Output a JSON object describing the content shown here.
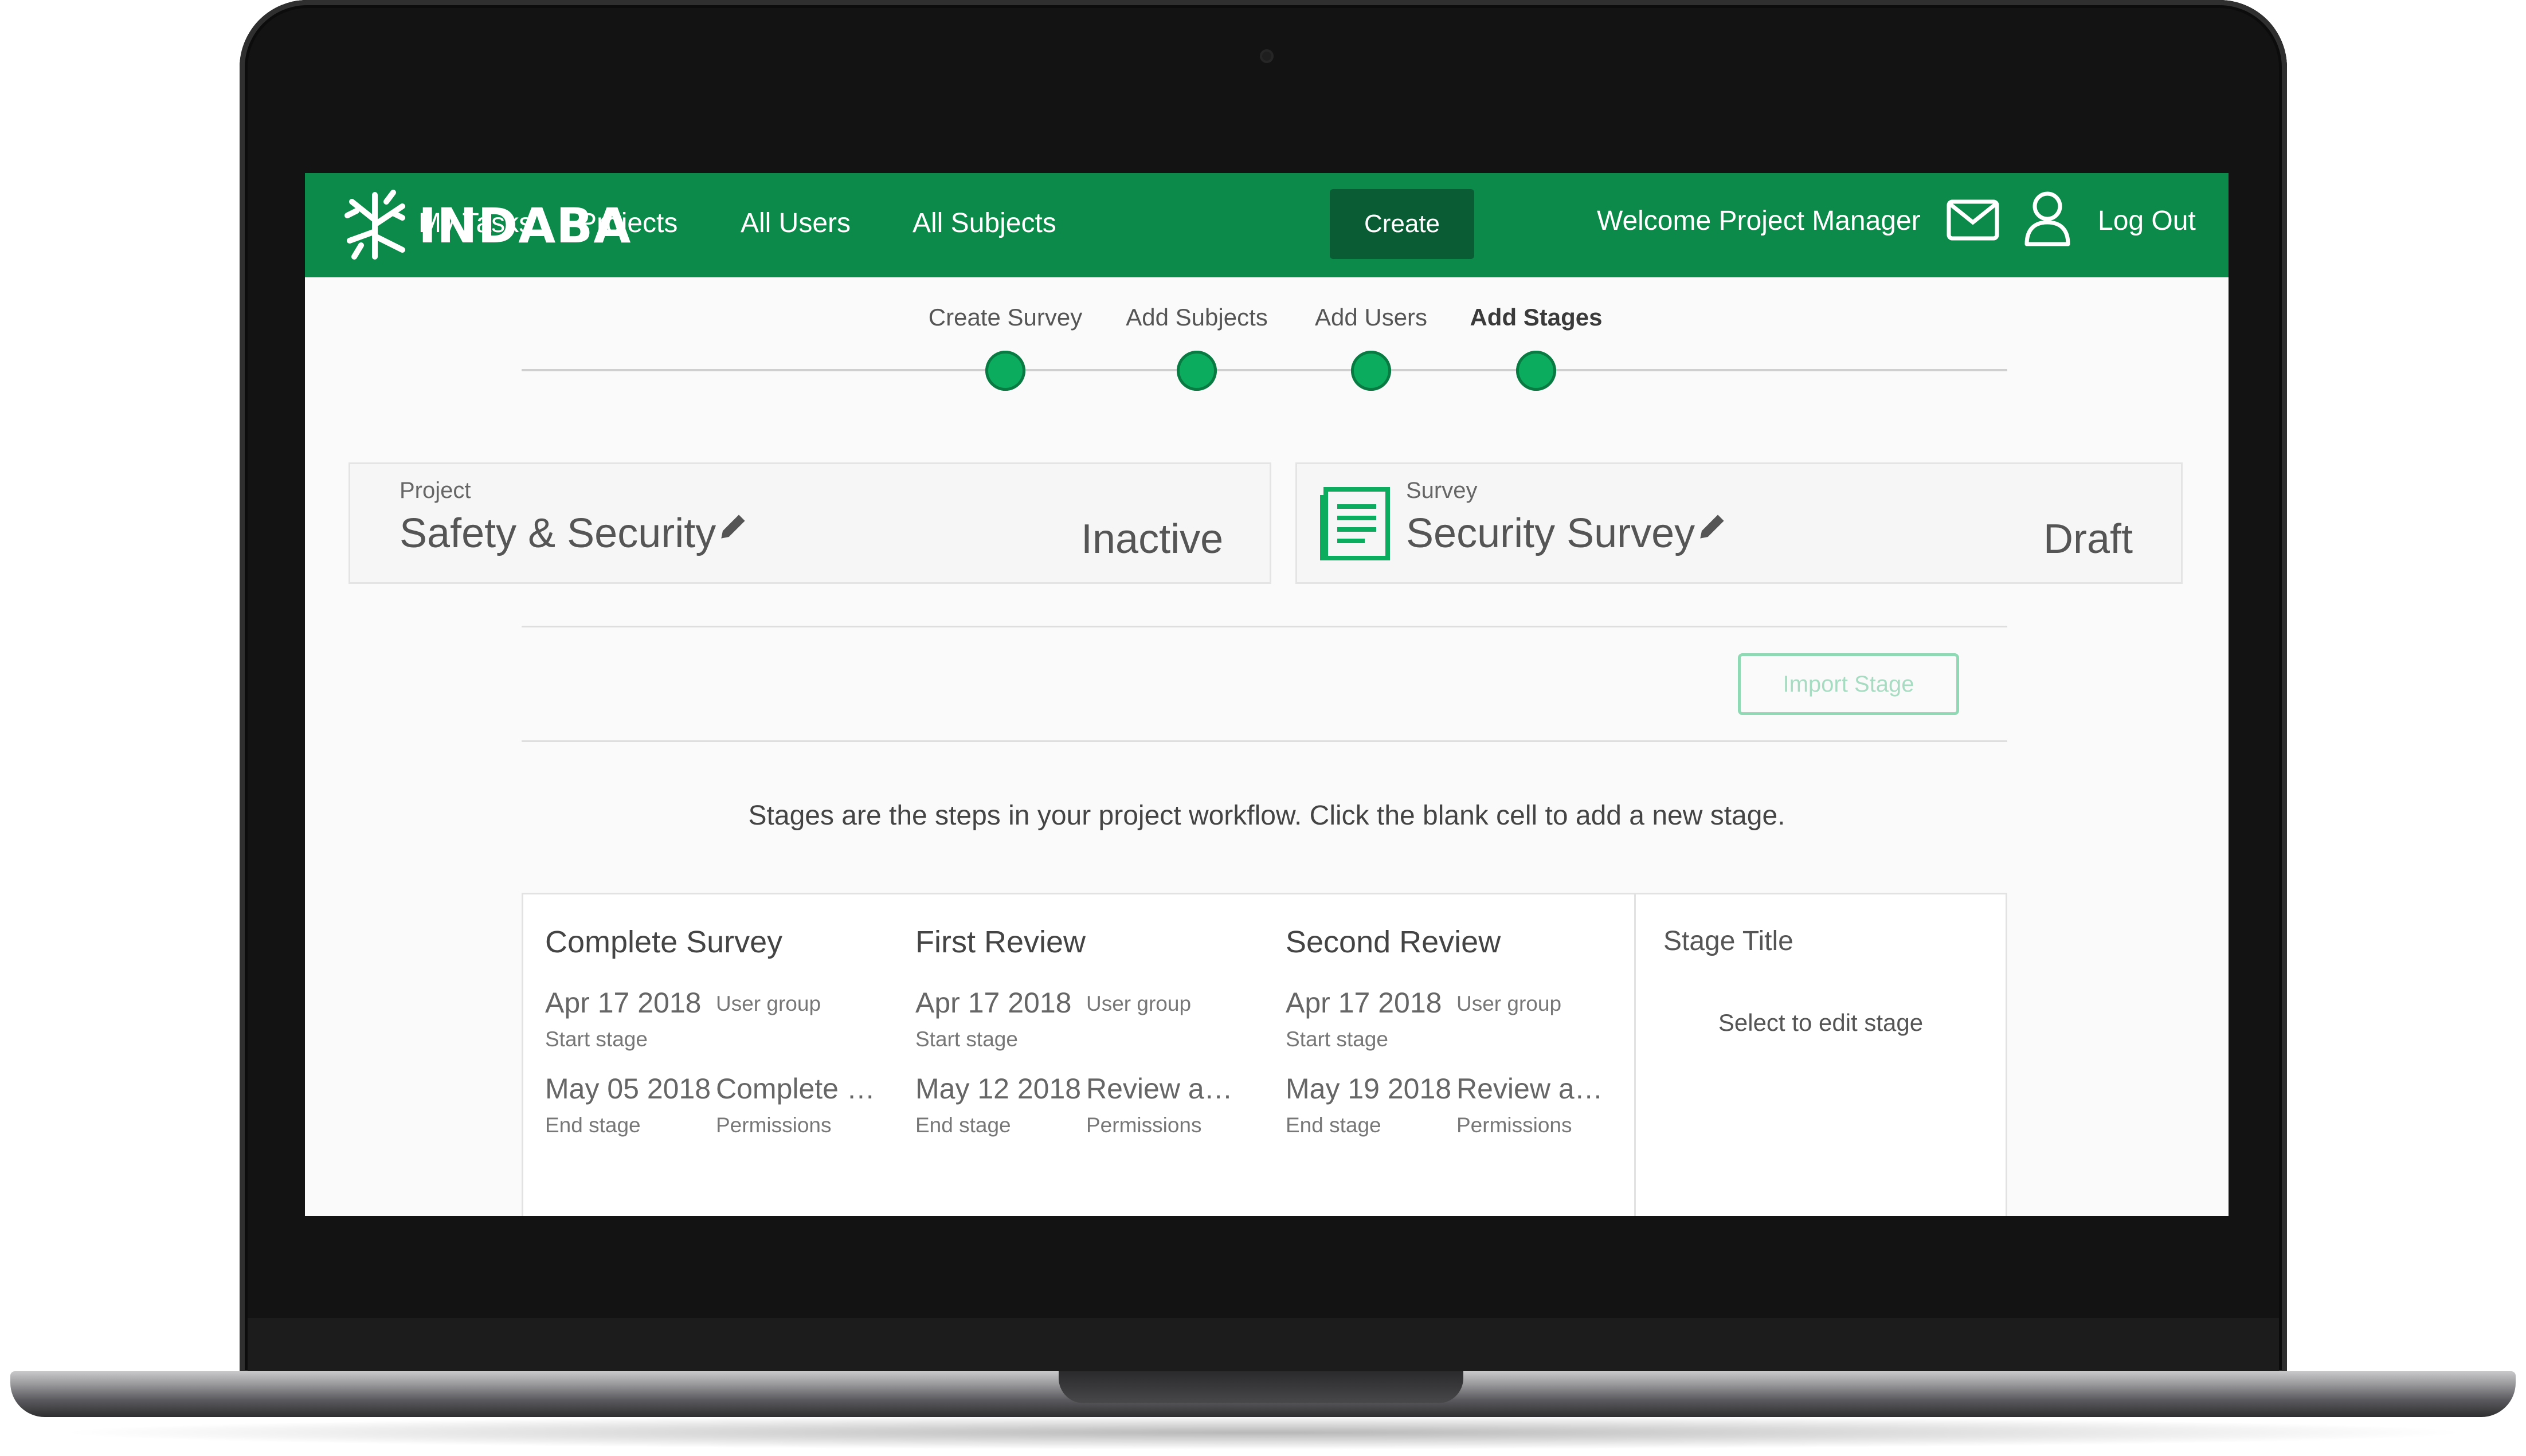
{
  "brand": {
    "name": "INDABA"
  },
  "nav": {
    "items": [
      "My Tasks",
      "Projects",
      "All Users",
      "All Subjects"
    ],
    "create_label": "Create",
    "welcome": "Welcome Project Manager",
    "logout": "Log Out"
  },
  "stepper": {
    "steps": [
      "Create Survey",
      "Add Subjects",
      "Add Users",
      "Add Stages"
    ],
    "active": "Add Stages"
  },
  "project": {
    "label": "Project",
    "title": "Safety & Security",
    "status": "Inactive"
  },
  "survey": {
    "label": "Survey",
    "title": "Security Survey",
    "status": "Draft"
  },
  "import_label": "Import Stage",
  "hint": "Stages are the steps in your project workflow. Click the blank cell to add a new stage.",
  "stages": [
    {
      "title": "Complete Survey",
      "start_date": "Apr 17 2018",
      "start_label": "Start stage",
      "group_label": "User group",
      "end_date": "May 05 2018",
      "end_label": "End stage",
      "permissions": "Complete S...",
      "permissions_label": "Permissions"
    },
    {
      "title": "First Review",
      "start_date": "Apr 17 2018",
      "start_label": "Start stage",
      "group_label": "User group",
      "end_date": "May 12 2018",
      "end_label": "End stage",
      "permissions": "Review and...",
      "permissions_label": "Permissions"
    },
    {
      "title": "Second Review",
      "start_date": "Apr 17 2018",
      "start_label": "Start stage",
      "group_label": "User group",
      "end_date": "May 19 2018",
      "end_label": "End stage",
      "permissions": "Review and...",
      "permissions_label": "Permissions"
    }
  ],
  "new_stage": {
    "title": "Stage Title",
    "hint": "Select to edit stage"
  },
  "colors": {
    "brand_green": "#0c8a4a",
    "create_button": "#0a5c35",
    "step_dot": "#0bac5e"
  },
  "icons": [
    "indaba-logo",
    "mail-icon",
    "user-icon",
    "pencil-icon",
    "document-icon"
  ]
}
